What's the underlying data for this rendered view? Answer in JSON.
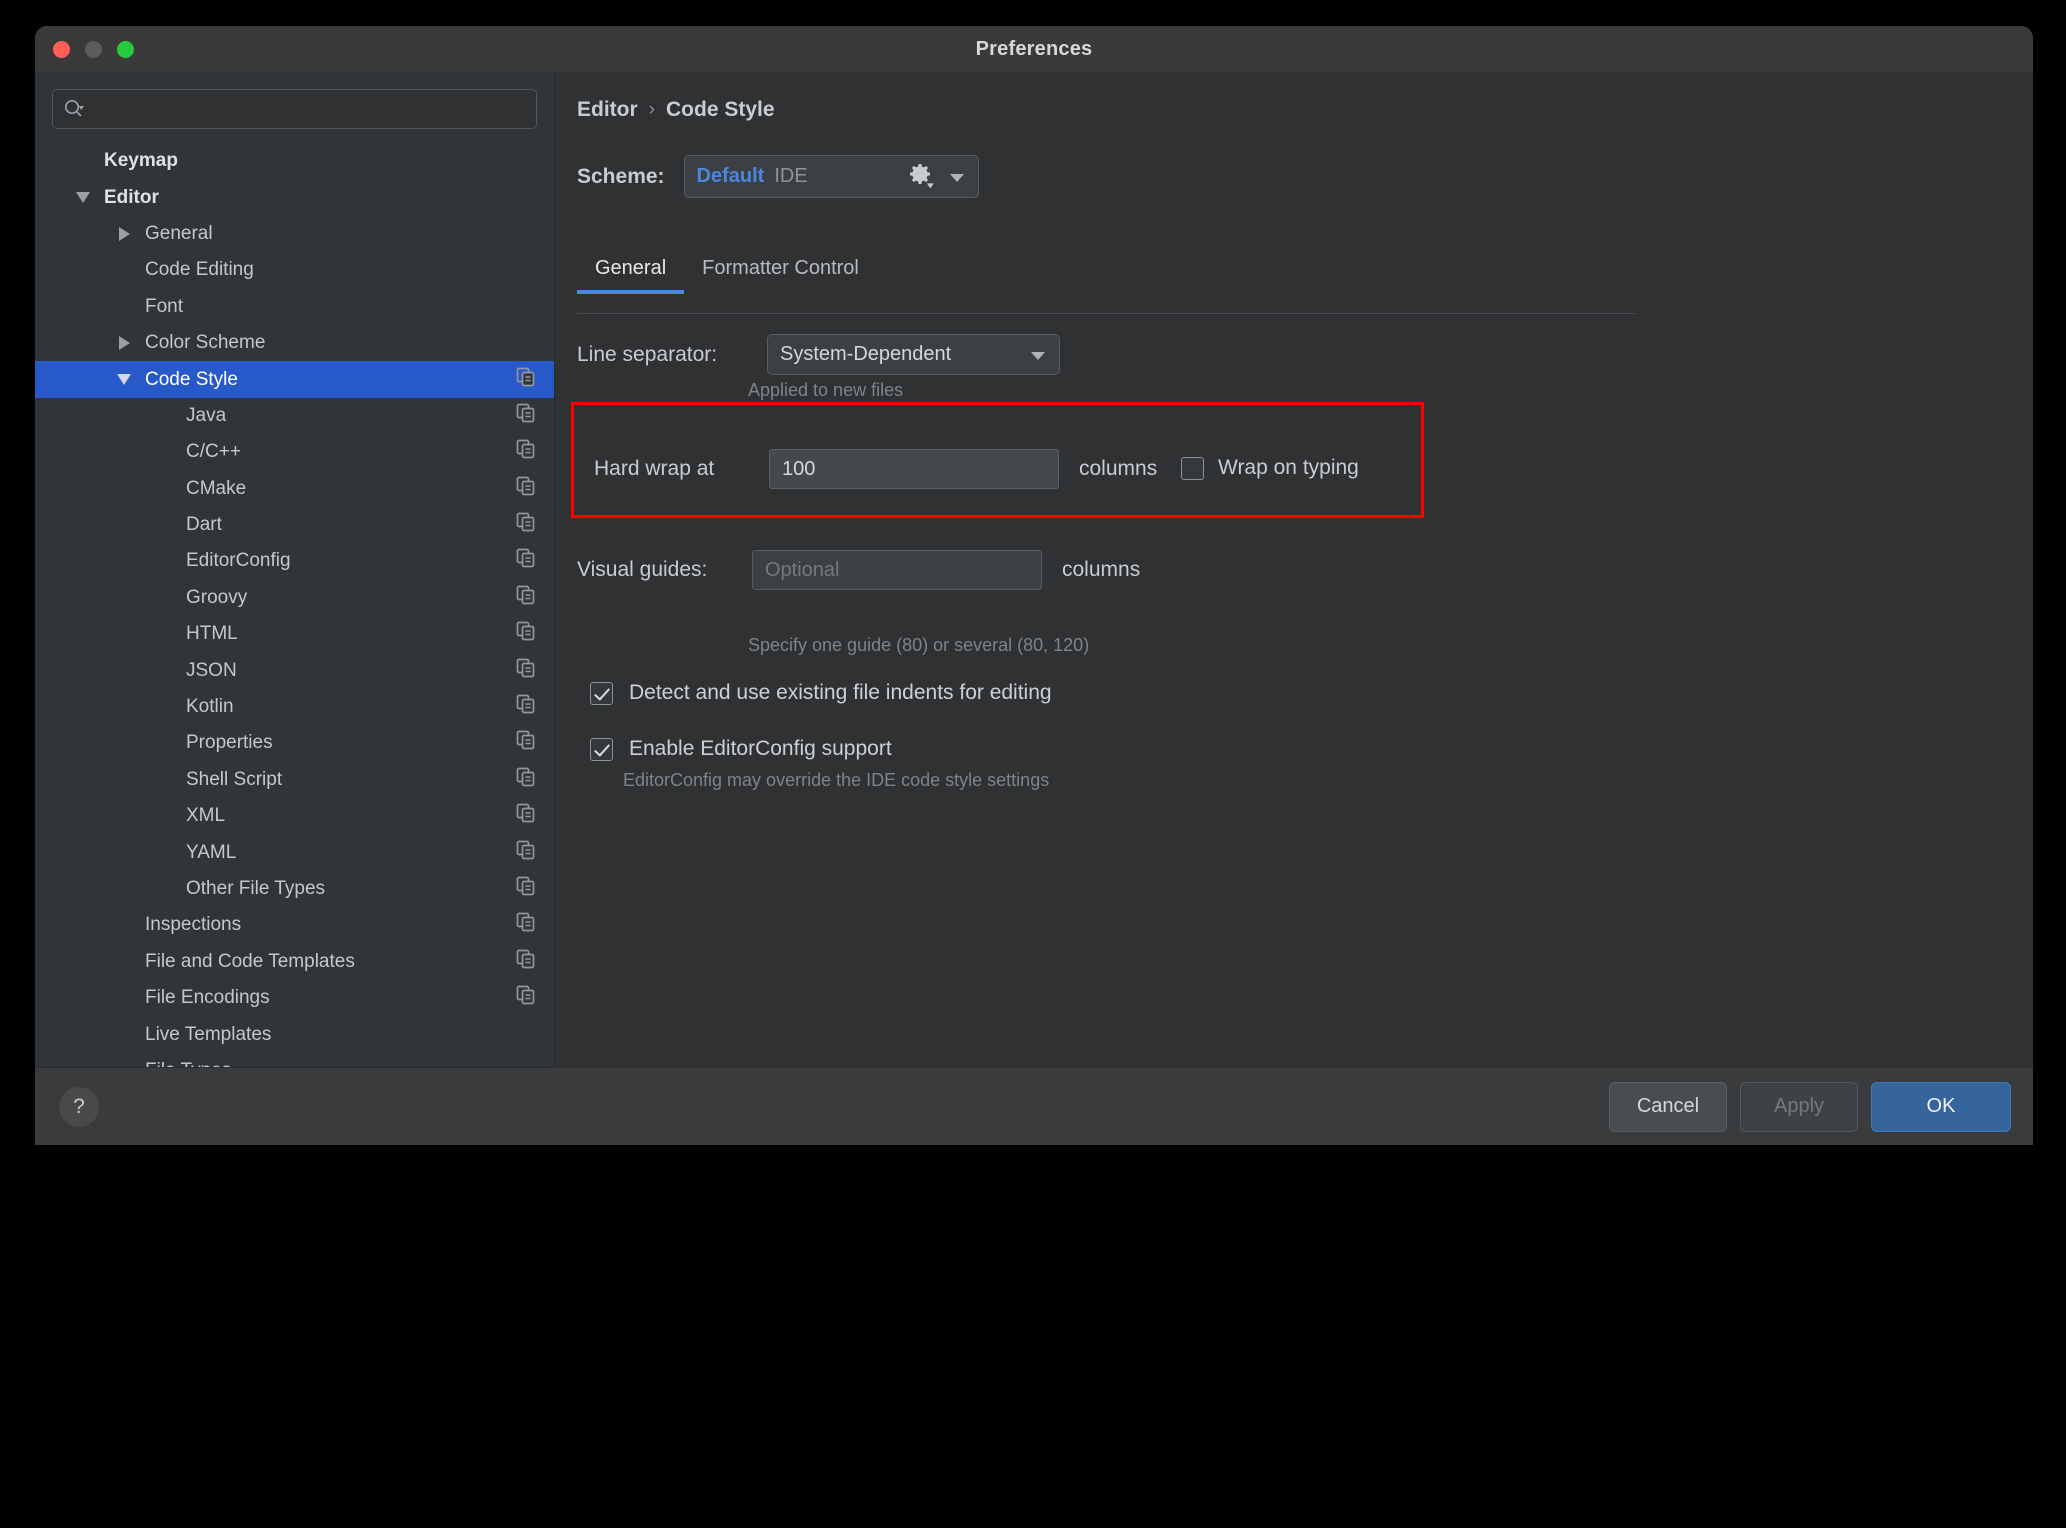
{
  "window": {
    "title": "Preferences",
    "traffic_lights": [
      "close",
      "minimize",
      "maximize"
    ]
  },
  "sidebar": {
    "search": {
      "placeholder": "",
      "value": "",
      "icon": "search-icon"
    },
    "items": [
      {
        "label": "Keymap",
        "indent": 0,
        "bold": true,
        "twisty": "none",
        "copy": false,
        "selected": false
      },
      {
        "label": "Editor",
        "indent": 0,
        "bold": true,
        "twisty": "expanded",
        "copy": false,
        "selected": false
      },
      {
        "label": "General",
        "indent": 1,
        "bold": false,
        "twisty": "collapsed",
        "copy": false,
        "selected": false
      },
      {
        "label": "Code Editing",
        "indent": 1,
        "bold": false,
        "twisty": "none",
        "copy": false,
        "selected": false
      },
      {
        "label": "Font",
        "indent": 1,
        "bold": false,
        "twisty": "none",
        "copy": false,
        "selected": false
      },
      {
        "label": "Color Scheme",
        "indent": 1,
        "bold": false,
        "twisty": "collapsed",
        "copy": false,
        "selected": false
      },
      {
        "label": "Code Style",
        "indent": 1,
        "bold": false,
        "twisty": "expanded",
        "copy": true,
        "selected": true
      },
      {
        "label": "Java",
        "indent": 2,
        "bold": false,
        "twisty": "none",
        "copy": true,
        "selected": false
      },
      {
        "label": "C/C++",
        "indent": 2,
        "bold": false,
        "twisty": "none",
        "copy": true,
        "selected": false
      },
      {
        "label": "CMake",
        "indent": 2,
        "bold": false,
        "twisty": "none",
        "copy": true,
        "selected": false
      },
      {
        "label": "Dart",
        "indent": 2,
        "bold": false,
        "twisty": "none",
        "copy": true,
        "selected": false
      },
      {
        "label": "EditorConfig",
        "indent": 2,
        "bold": false,
        "twisty": "none",
        "copy": true,
        "selected": false
      },
      {
        "label": "Groovy",
        "indent": 2,
        "bold": false,
        "twisty": "none",
        "copy": true,
        "selected": false
      },
      {
        "label": "HTML",
        "indent": 2,
        "bold": false,
        "twisty": "none",
        "copy": true,
        "selected": false
      },
      {
        "label": "JSON",
        "indent": 2,
        "bold": false,
        "twisty": "none",
        "copy": true,
        "selected": false
      },
      {
        "label": "Kotlin",
        "indent": 2,
        "bold": false,
        "twisty": "none",
        "copy": true,
        "selected": false
      },
      {
        "label": "Properties",
        "indent": 2,
        "bold": false,
        "twisty": "none",
        "copy": true,
        "selected": false
      },
      {
        "label": "Shell Script",
        "indent": 2,
        "bold": false,
        "twisty": "none",
        "copy": true,
        "selected": false
      },
      {
        "label": "XML",
        "indent": 2,
        "bold": false,
        "twisty": "none",
        "copy": true,
        "selected": false
      },
      {
        "label": "YAML",
        "indent": 2,
        "bold": false,
        "twisty": "none",
        "copy": true,
        "selected": false
      },
      {
        "label": "Other File Types",
        "indent": 2,
        "bold": false,
        "twisty": "none",
        "copy": true,
        "selected": false
      },
      {
        "label": "Inspections",
        "indent": 1,
        "bold": false,
        "twisty": "none",
        "copy": true,
        "selected": false
      },
      {
        "label": "File and Code Templates",
        "indent": 1,
        "bold": false,
        "twisty": "none",
        "copy": true,
        "selected": false
      },
      {
        "label": "File Encodings",
        "indent": 1,
        "bold": false,
        "twisty": "none",
        "copy": true,
        "selected": false
      },
      {
        "label": "Live Templates",
        "indent": 1,
        "bold": false,
        "twisty": "none",
        "copy": false,
        "selected": false
      },
      {
        "label": "File Types",
        "indent": 1,
        "bold": false,
        "twisty": "none",
        "copy": false,
        "selected": false
      }
    ]
  },
  "main": {
    "breadcrumb": {
      "root": "Editor",
      "separator": "›",
      "current": "Code Style"
    },
    "scheme": {
      "label": "Scheme:",
      "selected_name": "Default",
      "selected_scope": "IDE",
      "gear_icon": "gear-icon"
    },
    "tabs": [
      {
        "label": "General",
        "active": true
      },
      {
        "label": "Formatter Control",
        "active": false
      }
    ],
    "line_separator": {
      "label": "Line separator:",
      "value": "System-Dependent",
      "hint": "Applied to new files"
    },
    "hard_wrap": {
      "label": "Hard wrap at",
      "value": "100",
      "unit": "columns",
      "wrap_on_typing_label": "Wrap on typing",
      "wrap_on_typing_checked": false,
      "highlight_color": "#ff0000"
    },
    "visual_guides": {
      "label": "Visual guides:",
      "value": "",
      "placeholder": "Optional",
      "unit": "columns",
      "hint": "Specify one guide (80) or several (80, 120)"
    },
    "options": [
      {
        "label": "Detect and use existing file indents for editing",
        "checked": true
      },
      {
        "label": "Enable EditorConfig support",
        "checked": true
      }
    ],
    "editorconfig_hint": "EditorConfig may override the IDE code style settings"
  },
  "footer": {
    "help_label": "?",
    "cancel_label": "Cancel",
    "apply_label": "Apply",
    "ok_label": "OK"
  },
  "colors": {
    "accent_blue": "#4a88e0",
    "selection_blue": "#2759c9",
    "ok_button": "#36659e",
    "highlight_red": "#ff0000"
  }
}
